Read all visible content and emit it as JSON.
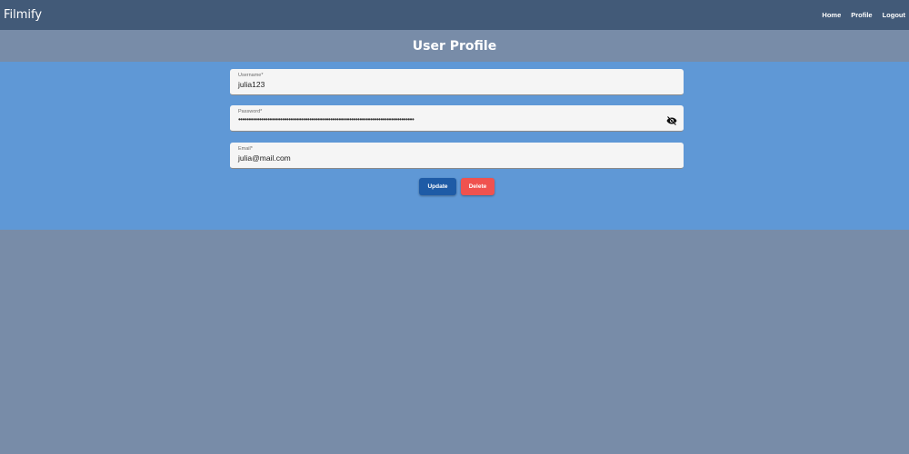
{
  "navbar": {
    "brand": "Filmify",
    "links": [
      {
        "label": "Home"
      },
      {
        "label": "Profile"
      },
      {
        "label": "Logout"
      }
    ]
  },
  "page": {
    "title": "User Profile"
  },
  "form": {
    "username": {
      "label": "Username*",
      "value": "julia123"
    },
    "password": {
      "label": "Password*",
      "value": "••••••••••••••••••••••••••••••••••••••••••••••••••••••••••••••••••••••••••••••••••••"
    },
    "email": {
      "label": "Email*",
      "value": "julia@mail.com"
    },
    "update_label": "Update",
    "delete_label": "Delete"
  },
  "colors": {
    "navbar": "#425a78",
    "header": "#788ca8",
    "content": "#5f98d6",
    "update": "#1e5ba6",
    "delete": "#f0524f"
  }
}
